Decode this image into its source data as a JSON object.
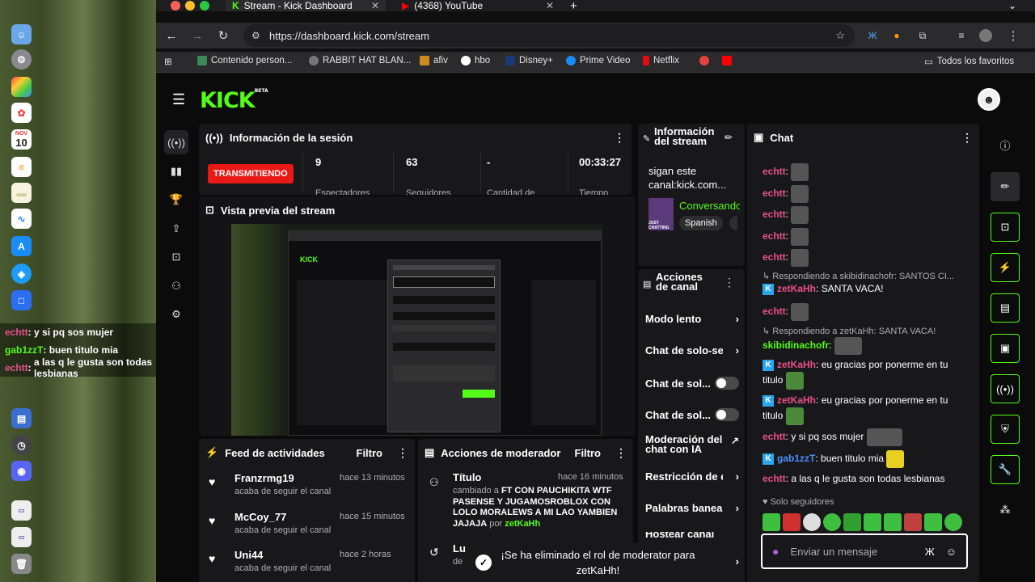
{
  "tabs": [
    {
      "label": "Stream - Kick Dashboard"
    },
    {
      "label": "(4368) YouTube"
    }
  ],
  "url": "https://dashboard.kick.com/stream",
  "bookmarks": [
    "Contenido person...",
    "RABBIT HAT BLAN...",
    "afiv",
    "hbo",
    "Disney+",
    "Prime Video",
    "Netflix"
  ],
  "bookmarks_all": "Todos los favoritos",
  "logo": "KICK",
  "logo_badge": "BETA",
  "session": {
    "title": "Información de la sesión",
    "status": "TRANSMITIENDO",
    "stats": [
      {
        "value": "9",
        "label": "Espectadores"
      },
      {
        "value": "63",
        "label": "Seguidores"
      },
      {
        "value": "-",
        "label": "Cantidad de"
      },
      {
        "value": "00:33:27",
        "label": "Tiempo"
      }
    ]
  },
  "preview": {
    "title": "Vista previa del stream"
  },
  "feed": {
    "title": "Feed de actividades",
    "filter": "Filtro",
    "items": [
      {
        "name": "Franzrmg19",
        "time": "hace 13 minutos",
        "sub": "acaba de seguir el canal"
      },
      {
        "name": "McCoy_77",
        "time": "hace 15 minutos",
        "sub": "acaba de seguir el canal"
      },
      {
        "name": "Uni44",
        "time": "hace 2 horas",
        "sub": "acaba de seguir el canal"
      }
    ]
  },
  "mod": {
    "title": "Acciones de moderador",
    "filter": "Filtro",
    "item_title": "Título",
    "item_time": "hace 16 minutos",
    "item_prefix": "cambiado a",
    "item_text": "FT CON PAUCHIKITA WTF PASENSE Y JUGAMOSROBLOX CON LOLO MORALEWS A MI LAO YAMBIEN JAJAJA",
    "item_by": "por",
    "item_user": "zetKaHh",
    "second_title": "Lu",
    "second_sub": "de"
  },
  "stream_info": {
    "title": "Información del stream",
    "stream_title": "sigan este canal:kick.com...",
    "category": "Conversando",
    "tag": "Spanish",
    "thumb": "JUST CHATTING"
  },
  "actions": {
    "title": "Acciones de canal",
    "items": [
      "Modo lento",
      "Chat de solo-se",
      "Chat de sol...",
      "Chat de sol...",
      "Moderación del chat con IA",
      "Restricción de e",
      "Palabras banea",
      "Hostear canal"
    ]
  },
  "chat": {
    "title": "Chat",
    "lines": [
      {
        "user": "echtt"
      },
      {
        "user": "echtt"
      },
      {
        "user": "echtt"
      },
      {
        "user": "echtt"
      },
      {
        "user": "echtt"
      },
      {
        "reply": "Respondiendo a skibidinachofr: SANTOS CI..."
      },
      {
        "user": "zetKaHh",
        "text": "SANTA VACA!"
      },
      {
        "user": "echtt"
      },
      {
        "reply": "Respondiendo a zetKaHh: SANTA VACA!"
      },
      {
        "user": "skibidinachofr"
      },
      {
        "user": "zetKaHh",
        "text": "eu gracias por ponerme en tu titulo"
      },
      {
        "user": "zetKaHh",
        "text": "eu gracias por ponerme en tu titulo"
      },
      {
        "user": "echtt",
        "text": "y si pq sos mujer"
      },
      {
        "user": "gab1zzT",
        "text": "buen titulo mia"
      },
      {
        "user": "echtt",
        "text": "a las q le gusta son todas lesbianas"
      }
    ],
    "followers_only": "Solo seguidores",
    "input_placeholder": "Enviar un mensaje"
  },
  "overlay_chat": [
    {
      "user": "echtt",
      "text": "y si pq sos mujer"
    },
    {
      "user": "gab1zzT",
      "text": "buen titulo mia"
    },
    {
      "user": "echtt",
      "text": "a las q le gusta son todas lesbianas"
    }
  ],
  "dock_date": {
    "month": "NOV",
    "day": "10"
  },
  "toast": "¡Se ha eliminado el rol de moderator para zetKaHh!",
  "colors": {
    "brand": "#53fc18",
    "live": "#e91916",
    "username_pink": "#e8508b"
  }
}
